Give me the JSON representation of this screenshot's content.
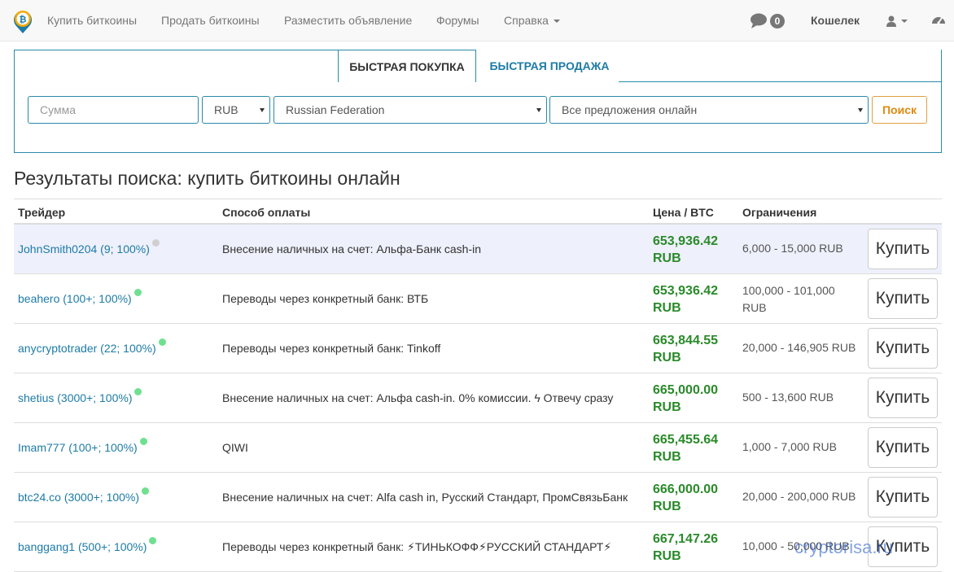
{
  "nav": {
    "links": [
      "Купить биткоины",
      "Продать биткоины",
      "Разместить объявление",
      "Форумы",
      "Справка"
    ],
    "chat_count": "0",
    "wallet": "Кошелек"
  },
  "search": {
    "tabs": [
      "Быстрая покупка",
      "Быстрая продажа"
    ],
    "amount_placeholder": "Сумма",
    "currency": "RUB",
    "country": "Russian Federation",
    "offers": "Все предложения онлайн",
    "button": "Поиск"
  },
  "results": {
    "title": "Результаты поиска: купить биткоины онлайн",
    "columns": [
      "Трейдер",
      "Способ оплаты",
      "Цена / BTC",
      "Ограничения"
    ],
    "rows": [
      {
        "trader": "JohnSmith0204 (9; 100%)",
        "online": false,
        "payment": "Внесение наличных на счет: Альфа-Банк cash-in",
        "price": "653,936.42 RUB",
        "limits": "6,000 - 15,000 RUB",
        "button": "Купить"
      },
      {
        "trader": "beahero (100+; 100%)",
        "online": true,
        "payment": "Переводы через конкретный банк: ВТБ",
        "price": "653,936.42 RUB",
        "limits": "100,000 - 101,000 RUB",
        "button": "Купить"
      },
      {
        "trader": "anycryptotrader (22; 100%)",
        "online": true,
        "payment": "Переводы через конкретный банк: Tinkoff",
        "price": "663,844.55 RUB",
        "limits": "20,000 - 146,905 RUB",
        "button": "Купить"
      },
      {
        "trader": "shetius (3000+; 100%)",
        "online": true,
        "payment": "Внесение наличных на счет: Альфа cash-in. 0% комиссии. ϟ Отвечу сразу",
        "price": "665,000.00 RUB",
        "limits": "500 - 13,600 RUB",
        "button": "Купить"
      },
      {
        "trader": "Imam777 (100+; 100%)",
        "online": true,
        "payment": "QIWI",
        "price": "665,455.64 RUB",
        "limits": "1,000 - 7,000 RUB",
        "button": "Купить"
      },
      {
        "trader": "btc24.co (3000+; 100%)",
        "online": true,
        "payment": "Внесение наличных на счет: Alfa cash in, Русский Стандарт, ПромСвязьБанк",
        "price": "666,000.00 RUB",
        "limits": "20,000 - 200,000 RUB",
        "button": "Купить"
      },
      {
        "trader": "banggang1 (500+; 100%)",
        "online": true,
        "payment": "Переводы через конкретный банк: ⚡ТИНЬКОФФ⚡РУССКИЙ СТАНДАРТ⚡",
        "price": "667,147.26 RUB",
        "limits": "10,000 - 50,000 RUB",
        "button": "Купить"
      }
    ]
  },
  "watermark": "cryptorisa.ru",
  "colors": {
    "accent": "#2a8aa8",
    "link": "#1d7ba6",
    "price": "#2a8a2a",
    "search_button": "#e08a10",
    "online_dot": "#6fe08f"
  }
}
